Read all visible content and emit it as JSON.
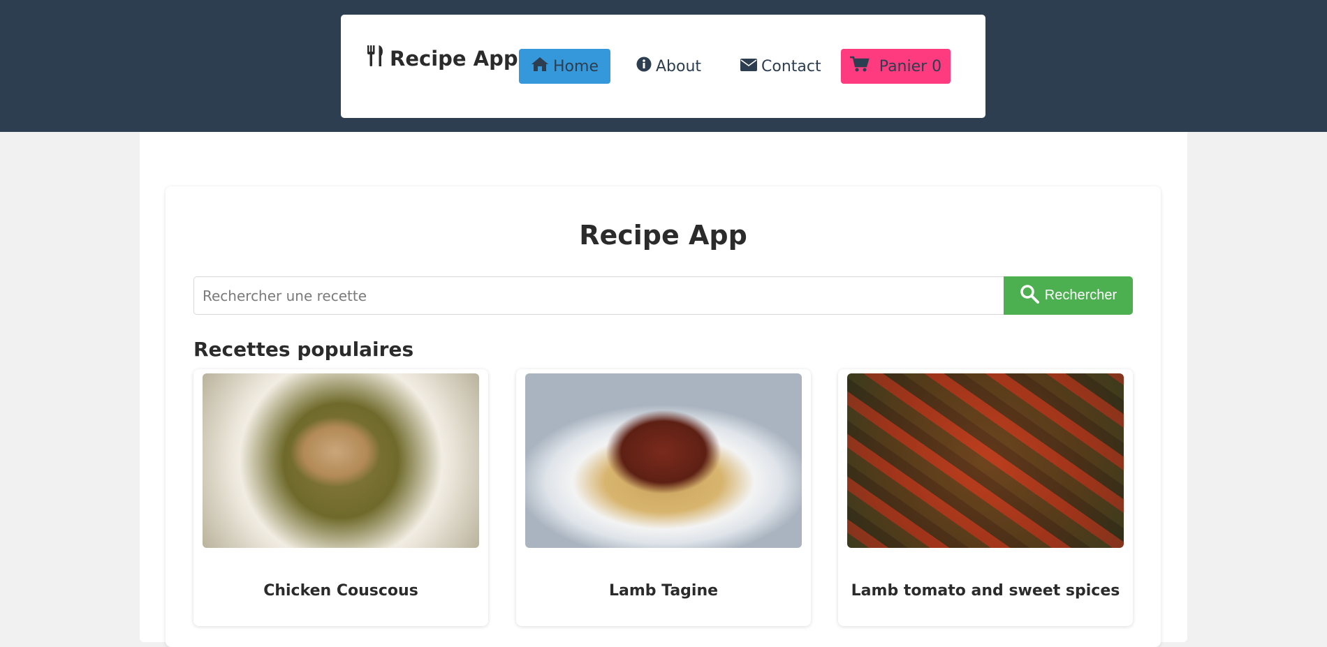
{
  "nav": {
    "brand": "Recipe App",
    "home_label": "Home",
    "about_label": "About",
    "contact_label": "Contact",
    "cart_label": "Panier 0"
  },
  "main": {
    "title": "Recipe App",
    "search": {
      "placeholder": "Rechercher une recette",
      "button_label": "Rechercher"
    },
    "section_title": "Recettes populaires",
    "recipes": [
      {
        "name": "Chicken Couscous"
      },
      {
        "name": "Lamb Tagine"
      },
      {
        "name": "Lamb tomato and sweet spices"
      }
    ]
  },
  "colors": {
    "header_bg": "#2c3e50",
    "home_button": "#3498db",
    "cart_button": "#ff3b7f",
    "search_button": "#4caf50"
  },
  "icons": {
    "brand": "utensils-icon",
    "home": "home-icon",
    "about": "info-circle-icon",
    "contact": "envelope-icon",
    "cart": "shopping-cart-icon",
    "search": "search-icon"
  }
}
